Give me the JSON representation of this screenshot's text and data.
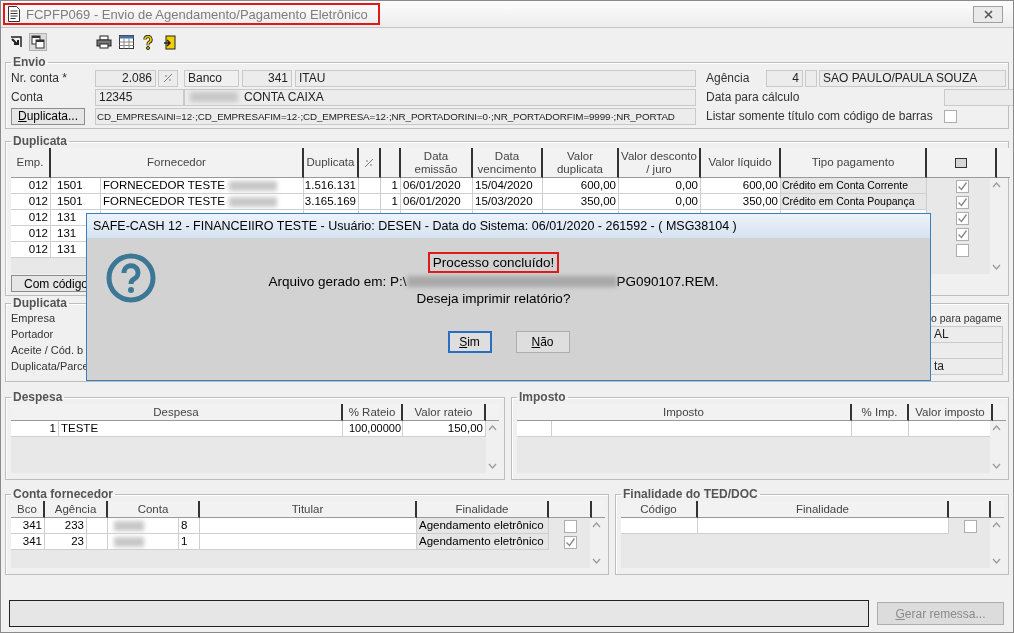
{
  "window": {
    "title": "FCPFP069 - Envio de Agendamento/Pagamento Eletrônico"
  },
  "envio": {
    "legend": "Envio",
    "nr_conta_label": "Nr. conta *",
    "nr_conta": "2.086",
    "banco_label": "Banco",
    "banco_code": "341",
    "banco_name": "ITAU",
    "agencia_label": "Agência",
    "agencia_code": "4",
    "agencia_name": "SAO PAULO/PAULA SOUZA",
    "conta_label": "Conta",
    "conta_code": "12345",
    "conta_name": "CONTA CAIXA",
    "data_label": "Data para cálculo",
    "duplicata_button": "Duplicata...",
    "filter": "CD_EMPRESAINI=12·;CD_EMPRESAFIM=12·;CD_EMPRESA=12·;NR_PORTADORINI=0·;NR_PORTADORFIM=9999·;NR_PORTAD",
    "listar_label": "Listar somente título com código de barras",
    "listar_checked": false
  },
  "duplicata": {
    "legend": "Duplicata",
    "columns": [
      {
        "label": "Emp."
      },
      {
        "label": "Fornecedor"
      },
      {
        "label": "Duplicata"
      },
      {
        "kind": "icon"
      },
      {
        "kind": "blank"
      },
      {
        "label": "Data emissão"
      },
      {
        "label": "Data vencimento"
      },
      {
        "label": "Valor duplicata"
      },
      {
        "label": "Valor desconto / juro"
      },
      {
        "label": "Valor líquido"
      },
      {
        "label": "Tipo pagamento"
      },
      {
        "kind": "check"
      }
    ],
    "rows": [
      {
        "emp": "012",
        "code": "1501",
        "name": "FORNECEDOR TESTE",
        "duplicata": "1.516.131",
        "parcela": "1",
        "emissao": "06/01/2020",
        "vencimento": "15/04/2020",
        "valor": "600,00",
        "desconto": "0,00",
        "liquido": "600,00",
        "tipo": "Crédito em Conta Corrente",
        "checked": true
      },
      {
        "emp": "012",
        "code": "1501",
        "name": "FORNECEDOR TESTE",
        "duplicata": "3.165.169",
        "parcela": "1",
        "emissao": "06/01/2020",
        "vencimento": "15/03/2020",
        "valor": "350,00",
        "desconto": "0,00",
        "liquido": "350,00",
        "tipo": "Crédito em Conta Poupança",
        "checked": true
      },
      {
        "emp": "012",
        "code": "131",
        "checked": true
      },
      {
        "emp": "012",
        "code": "131",
        "checked": true
      },
      {
        "emp": "012",
        "code": "131",
        "checked": false
      }
    ],
    "com_codigo_button": "Com código"
  },
  "duplicata_detail": {
    "legend": "Duplicata",
    "labels": [
      "Empresa",
      "Portador",
      "Aceite / Cód. b",
      "Duplicata/Parce"
    ],
    "right_texts": [
      "o para pagame",
      "AL",
      "ta"
    ]
  },
  "dialog": {
    "title": "SAFE-CASH 12 - FINANCEIIRO TESTE - Usuário: DESEN - Data do Sistema: 06/01/2020 - 261592 - ( MSG38104 )",
    "headline": "Processo concluído!",
    "path_prefix": "Arquivo gerado em: P:\\",
    "path_suffix": "PG090107.REM.",
    "question": "Deseja imprimir relatório?",
    "buttons": [
      {
        "label": "Sim",
        "focused": true
      },
      {
        "label": "Não",
        "focused": false
      }
    ]
  },
  "despesa": {
    "legend": "Despesa",
    "columns": [
      "Despesa",
      "% Rateio",
      "Valor rateio"
    ],
    "rows": [
      {
        "index": "1",
        "name": "TESTE",
        "rateio": "100,00000",
        "valor": "150,00"
      }
    ]
  },
  "imposto": {
    "legend": "Imposto",
    "columns": [
      "Imposto",
      "% Imp.",
      "Valor imposto"
    ]
  },
  "conta_fornecedor": {
    "legend": "Conta fornecedor",
    "columns": [
      "Bco",
      "Agência",
      "Conta",
      "Titular",
      "Finalidade"
    ],
    "rows": [
      {
        "bco": "341",
        "agencia": "233",
        "digit": "8",
        "finalidade": "Agendamento eletrônico",
        "checked": false
      },
      {
        "bco": "341",
        "agencia": "23",
        "digit": "1",
        "finalidade": "Agendamento eletrônico",
        "checked": true
      }
    ]
  },
  "finalidade_ted": {
    "legend": "Finalidade do TED/DOC",
    "columns": [
      "Código",
      "Finalidade"
    ],
    "rows": [
      {
        "checked": false
      }
    ]
  },
  "footer": {
    "gerar_button": {
      "label": "Gerar remessa...",
      "disabled": true
    }
  }
}
